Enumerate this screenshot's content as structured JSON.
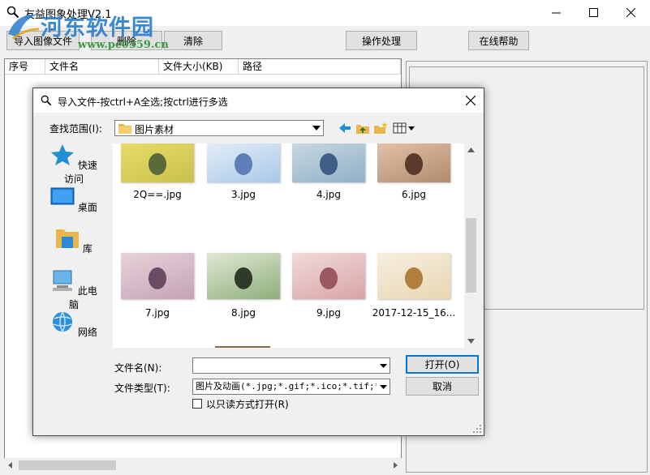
{
  "window": {
    "title": "友益图象处理V2.1",
    "watermark_logo": "河东软件园",
    "watermark_url": "www.pc0359.cn"
  },
  "toolbar": {
    "import_label": "导入图像文件",
    "delete_label": "删除",
    "clear_label": "清除",
    "process_label": "操作处理",
    "help_label": "在线帮助"
  },
  "list": {
    "columns": [
      "序号",
      "文件名",
      "文件大小(KB)",
      "路径"
    ]
  },
  "dialog": {
    "title": "导入文件-按ctrl+A全选;按ctrl进行多选",
    "look_in_label": "查找范围(I):",
    "look_in_value": "图片素材",
    "places": [
      "快速访问",
      "桌面",
      "库",
      "此电脑",
      "网络"
    ],
    "files": [
      {
        "name": "2Q==.jpg",
        "palette": [
          "#c9c14d",
          "#5a6a3a",
          "#e8dc6a"
        ]
      },
      {
        "name": "3.jpg",
        "palette": [
          "#a9c8e8",
          "#5e7fb5",
          "#e4eef8"
        ]
      },
      {
        "name": "4.jpg",
        "palette": [
          "#8fb0c8",
          "#3e5e88",
          "#c9d8e0"
        ]
      },
      {
        "name": "6.jpg",
        "palette": [
          "#b08a6e",
          "#5a3a2a",
          "#e3c3a8"
        ]
      },
      {
        "name": "7.jpg",
        "palette": [
          "#c4a3b6",
          "#6b4b63",
          "#e7d2da"
        ]
      },
      {
        "name": "8.jpg",
        "palette": [
          "#8fae7a",
          "#2f3a28",
          "#e0e8d4"
        ]
      },
      {
        "name": "9.jpg",
        "palette": [
          "#d8a4a6",
          "#9a5860",
          "#f1dada"
        ]
      },
      {
        "name": "2017-12-15_16...",
        "palette": [
          "#e8d6b2",
          "#b27f3f",
          "#f6efe0"
        ]
      }
    ],
    "filename_label": "文件名(N):",
    "filename_value": "",
    "filetype_label": "文件类型(T):",
    "filetype_value": "图片及动画(*.jpg;*.gif;*.ico;*.tif;*.",
    "readonly_label": "以只读方式打开(R)",
    "open_label": "打开(O)",
    "cancel_label": "取消"
  },
  "colors": {
    "accent": "#0078d7",
    "folder": "#e8b64a"
  }
}
